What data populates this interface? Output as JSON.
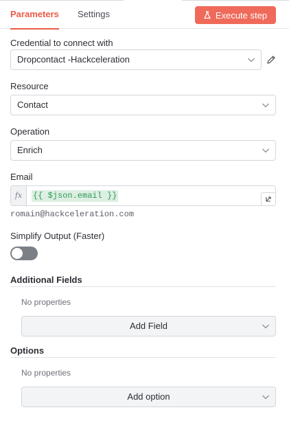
{
  "tabs": [
    {
      "label": "Parameters",
      "active": true
    },
    {
      "label": "Settings",
      "active": false
    }
  ],
  "execute_button": {
    "label": "Execute step",
    "icon": "flask-icon",
    "color": "#ef6a5a"
  },
  "credential": {
    "label": "Credential to connect with",
    "value": "Dropcontact -Hackceleration"
  },
  "resource": {
    "label": "Resource",
    "value": "Contact"
  },
  "operation": {
    "label": "Operation",
    "value": "Enrich"
  },
  "email": {
    "label": "Email",
    "fx": "fx",
    "expression": "{{ $json.email }}",
    "resolved": "romain@hackceleration.com"
  },
  "simplify": {
    "label": "Simplify Output (Faster)",
    "enabled": false
  },
  "additional_fields": {
    "title": "Additional Fields",
    "empty_text": "No properties",
    "add_label": "Add Field"
  },
  "options": {
    "title": "Options",
    "empty_text": "No properties",
    "add_label": "Add option"
  },
  "colors": {
    "accent": "#ea5a44",
    "expression_bg": "#dcefe2",
    "expression_text": "#2f9a55"
  }
}
